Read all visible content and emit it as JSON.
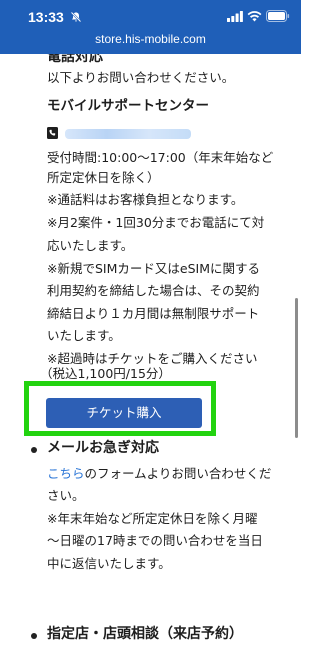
{
  "status_bar": {
    "time": "13:33"
  },
  "browser": {
    "url": "store.his-mobile.com"
  },
  "phone_section": {
    "heading_partial": "電話対応",
    "intro": "以下よりお問い合わせください。",
    "center_name": "モバイルサポートセンター",
    "hours_line1": "受付時間:10:00〜17:00（年末年始など",
    "hours_line2": "所定定休日を除く）",
    "note_fee": "※通話料はお客様負担となります。",
    "note_limit_1": "※月2案件・1回30分までお電話にて対",
    "note_limit_2": "応いたします。",
    "note_new_1": "※新規でSIMカード又はeSIMに関する",
    "note_new_2": "利用契約を締結した場合は、その契約",
    "note_new_3": "締結日より１カ月間は無制限サポート",
    "note_new_4": "いたします。",
    "note_over_1": "※超過時はチケットをご購入ください",
    "note_over_2": "（税込1,100円/15分）",
    "ticket_button": "チケット購入"
  },
  "mail_section": {
    "heading": "メールお急ぎ対応",
    "link_text": "こちら",
    "line1_rest": "のフォームよりお問い合わせくだ",
    "line2": "さい。",
    "note_1": "※年末年始など所定定休日を除く月曜",
    "note_2": "〜日曜の17時までの問い合わせを当日",
    "note_3": "中に返信いたします。"
  },
  "store_section": {
    "heading": "指定店・店頭相談（来店予約）"
  },
  "colors": {
    "chrome_blue": "#1f5fb8",
    "button_blue": "#2d5fb5",
    "highlight_green": "#22d30f",
    "link_blue": "#2a75d6"
  }
}
